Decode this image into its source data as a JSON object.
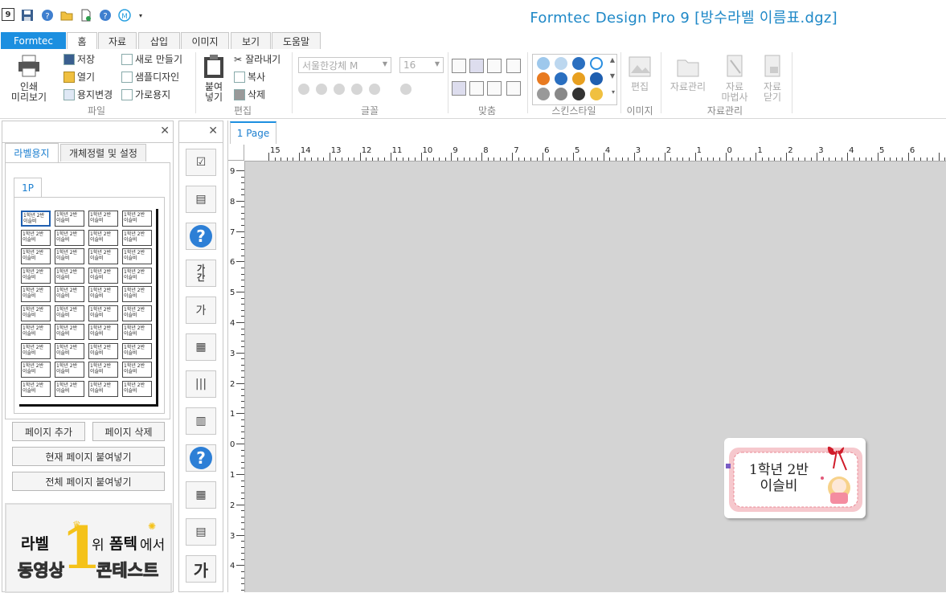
{
  "window": {
    "title": "Formtec Design Pro 9 [방수라벨 이름표.dgz]",
    "app_icon_text": "9"
  },
  "quick_access": [
    "save-icon",
    "help-icon",
    "open-folder-icon",
    "new-file-icon",
    "help-icon",
    "update-icon",
    "chevron-down-icon"
  ],
  "tabs": [
    {
      "label": "Formtec"
    },
    {
      "label": "홈"
    },
    {
      "label": "자료"
    },
    {
      "label": "삽입"
    },
    {
      "label": "이미지"
    },
    {
      "label": "보기"
    },
    {
      "label": "도움말"
    }
  ],
  "ribbon": {
    "file": {
      "print_preview": "인쇄\n미리보기",
      "save": "저장",
      "open": "열기",
      "change_paper": "용지변경",
      "new": "새로 만들기",
      "sample": "샘플디자인",
      "landscape": "가로용지",
      "group": "파일"
    },
    "edit": {
      "paste": "붙여\n넣기",
      "cut": "잘라내기",
      "copy": "복사",
      "delete": "삭제",
      "group": "편집"
    },
    "font": {
      "font_name": "서울한강체 M",
      "font_size": "16",
      "group": "글꼴"
    },
    "align": {
      "group": "맞춤"
    },
    "skin": {
      "group": "스킨스타일"
    },
    "image": {
      "edit": "편집",
      "group": "이미지"
    },
    "data": {
      "manage": "자료관리",
      "wizard": "자료\n마법사",
      "close": "자료\n닫기",
      "group": "자료관리"
    }
  },
  "left_panel": {
    "tabs": [
      {
        "label": "라벨용지"
      },
      {
        "label": "개체정렬 및 설정"
      }
    ],
    "page_tab": "1P",
    "cell_text": "1학년 2반\n이슬비",
    "buttons": {
      "add_page": "페이지 추가",
      "delete_page": "페이지 삭제",
      "paste_current": "현재 페이지 붙여넣기",
      "paste_all": "전체 페이지 붙여넣기"
    },
    "banner": {
      "line1_a": "라벨",
      "rank": "1",
      "line1_b": "위",
      "brand": "폼텍",
      "line1_c": "에서",
      "line2_a": "동영상",
      "line2_b": "콘테스트"
    }
  },
  "canvas": {
    "page_tab": "1 Page",
    "ruler_top": [
      "15",
      "14",
      "13",
      "12",
      "11",
      "10",
      "9",
      "8",
      "7",
      "6",
      "5",
      "4",
      "3",
      "2",
      "1",
      "0",
      "1",
      "2",
      "3",
      "4",
      "5",
      "6"
    ],
    "ruler_left": [
      "9",
      "8",
      "7",
      "6",
      "5",
      "4",
      "3",
      "2",
      "1",
      "0",
      "1",
      "2",
      "3",
      "4"
    ],
    "label": {
      "line1": "1학년 2반",
      "line2": "이슬비"
    }
  },
  "colors": {
    "accent": "#1c8fe0",
    "title": "#1e88c7",
    "workspace": "#d4d4d4",
    "label_border": "#f2a0a8"
  }
}
